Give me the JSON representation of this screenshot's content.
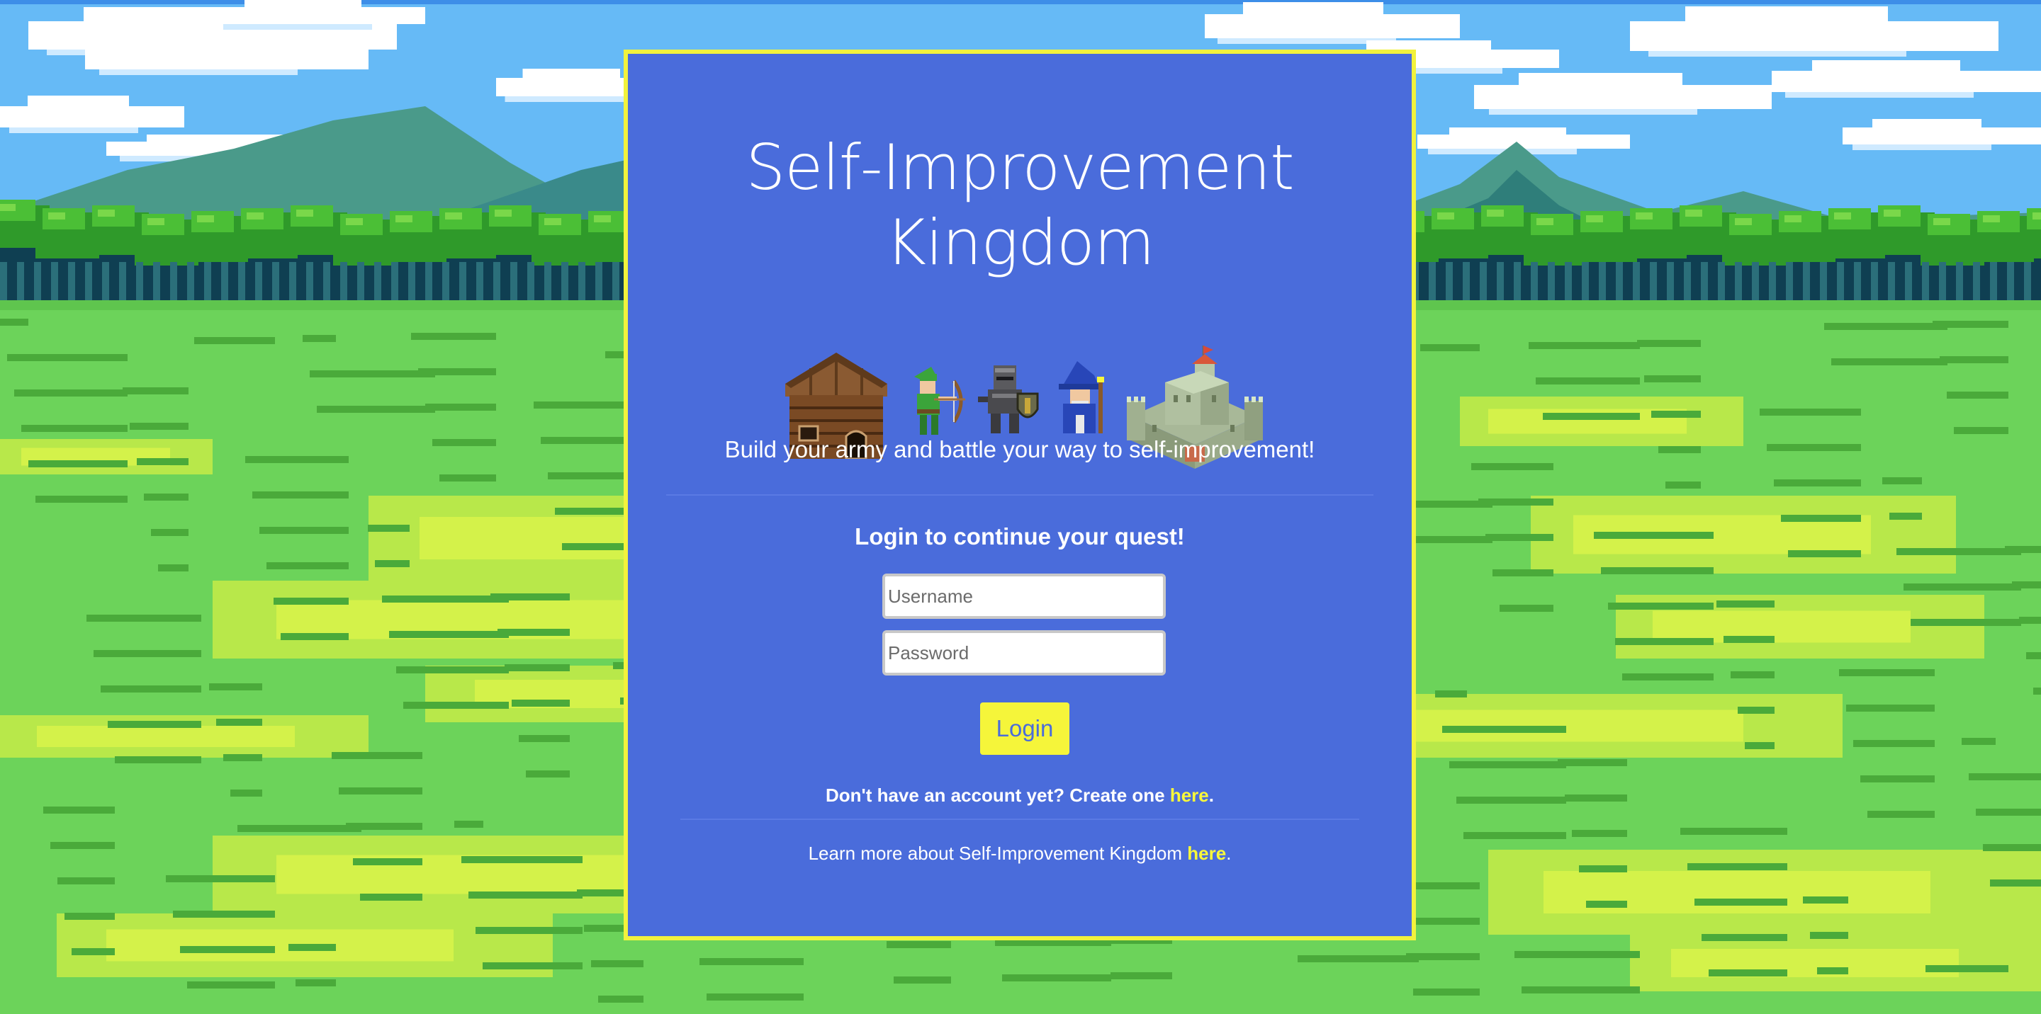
{
  "app": {
    "title_line1": "Self-Improvement",
    "title_line2": "Kingdom",
    "tagline": "Build your army and battle your way to self-improvement!"
  },
  "sprites": [
    "cabin-icon",
    "archer-icon",
    "knight-icon",
    "wizard-icon",
    "castle-icon"
  ],
  "login": {
    "prompt": "Login to continue your quest!",
    "username_placeholder": "Username",
    "password_placeholder": "Password",
    "button_label": "Login"
  },
  "signup": {
    "text": "Don't have an account yet? Create one ",
    "link_label": "here",
    "suffix": "."
  },
  "learn_more": {
    "text": "Learn more about Self-Improvement Kingdom ",
    "link_label": "here",
    "suffix": "."
  },
  "colors": {
    "card_bg": "#4a6cdb",
    "card_border": "#f2f23c",
    "accent_yellow": "#f5f53a",
    "sky": "#66baf6",
    "grass": "#6cd35a"
  }
}
